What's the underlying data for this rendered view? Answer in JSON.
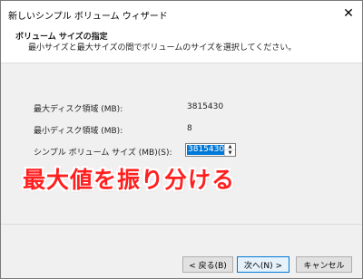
{
  "window": {
    "title": "新しいシンプル ボリューム ウィザード",
    "close_glyph": "✕"
  },
  "header": {
    "title": "ボリューム サイズの指定",
    "subtitle": "最小サイズと最大サイズの間でボリュームのサイズを選択してください。"
  },
  "fields": {
    "max_label": "最大ディスク領域 (MB):",
    "max_value": "3815430",
    "min_label": "最小ディスク領域 (MB):",
    "min_value": "8",
    "size_label": "シンプル ボリューム サイズ (MB)(S):",
    "size_value": "3815430"
  },
  "annotation": {
    "text": "最大値を振り分ける",
    "color": "#ff1f1f"
  },
  "buttons": {
    "back": "< 戻る(B)",
    "next": "次へ(N) >",
    "cancel": "キャンセル"
  },
  "colors": {
    "accent": "#0078d7"
  }
}
